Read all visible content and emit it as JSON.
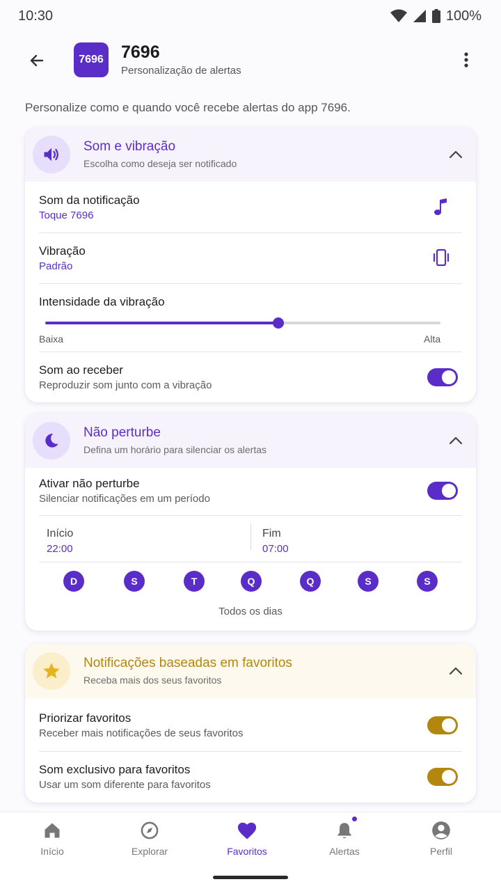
{
  "status": {
    "time": "10:30",
    "battery": "100%"
  },
  "app": {
    "logo_text": "7696",
    "title": "7696",
    "subtitle": "Personalização de alertas"
  },
  "intro": "Personalize como e quando você recebe alertas do app 7696.",
  "sound": {
    "title": "Som e vibração",
    "subtitle": "Escolha como deseja ser notificado",
    "notification_sound": {
      "label": "Som da notificação",
      "value": "Toque 7696"
    },
    "vibration": {
      "label": "Vibração",
      "value": "Padrão"
    },
    "intensity": {
      "label": "Intensidade da vibração",
      "min_label": "Baixa",
      "max_label": "Alta",
      "level": 0.59
    },
    "sound_on_receive": {
      "label": "Som ao receber",
      "description": "Reproduzir som junto com a vibração",
      "enabled": true
    }
  },
  "dnd": {
    "title": "Não perturbe",
    "subtitle": "Defina um horário para silenciar os alertas",
    "enable": {
      "label": "Ativar não perturbe",
      "description": "Silenciar notificações em um período",
      "enabled": true
    },
    "start": {
      "label": "Início",
      "value": "22:00"
    },
    "end": {
      "label": "Fim",
      "value": "07:00"
    },
    "days": [
      "D",
      "S",
      "T",
      "Q",
      "Q",
      "S",
      "S"
    ],
    "days_caption": "Todos os dias"
  },
  "favorites": {
    "title": "Notificações baseadas em favoritos",
    "subtitle": "Receba mais dos seus favoritos",
    "prioritize": {
      "label": "Priorizar favoritos",
      "description": "Receber mais notificações de seus favoritos",
      "enabled": true
    },
    "exclusive_sound": {
      "label": "Som exclusivo para favoritos",
      "description": "Usar um som diferente para favoritos",
      "enabled": true
    }
  },
  "nav": {
    "items": [
      {
        "label": "Início",
        "icon": "home-icon"
      },
      {
        "label": "Explorar",
        "icon": "compass-icon"
      },
      {
        "label": "Favoritos",
        "icon": "heart-icon",
        "active": true
      },
      {
        "label": "Alertas",
        "icon": "bell-icon"
      },
      {
        "label": "Perfil",
        "icon": "profile-icon"
      }
    ]
  },
  "colors": {
    "accent": "#5b2dc8",
    "gold": "#b3860e"
  }
}
